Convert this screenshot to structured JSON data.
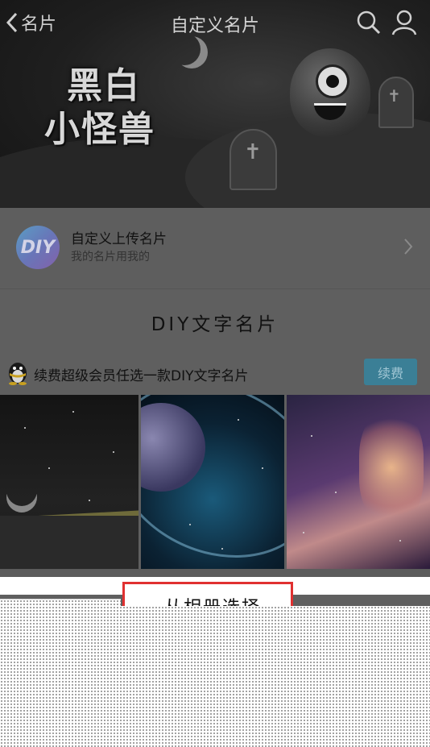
{
  "header": {
    "back_label": "名片",
    "title": "自定义名片",
    "icons": [
      "chevron-left-icon",
      "search-icon",
      "user-icon"
    ]
  },
  "banner": {
    "logo_line1": "黑白",
    "logo_line2": "小怪兽"
  },
  "upload": {
    "avatar_text": "DIY",
    "title": "自定义上传名片",
    "subtitle": "我的名片用我的"
  },
  "section": {
    "title": "DIY文字名片"
  },
  "renew": {
    "text": "续费超级会员任选一款DIY文字名片",
    "button_label": "续费"
  },
  "sheet": {
    "option_label": "从相册选择"
  },
  "colors": {
    "renew_button": "#3b7f96",
    "highlight_border": "#e03030",
    "overlay": "#5f5f5f"
  }
}
